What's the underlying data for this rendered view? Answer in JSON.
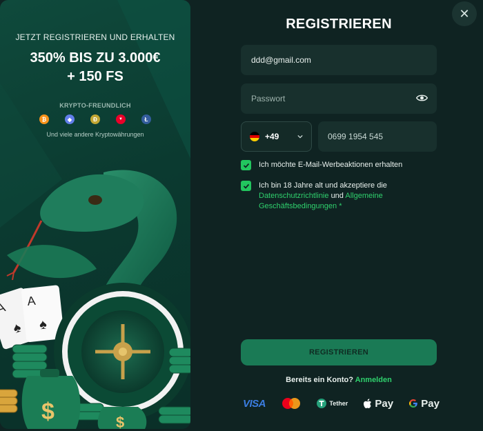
{
  "promo": {
    "subtitle": "JETZT REGISTRIEREN UND ERHALTEN",
    "headline_1": "350% BIS ZU 3.000€",
    "headline_2": "+ 150 FS",
    "crypto_label": "KRYPTO-FREUNDLICH",
    "crypto_note": "Und viele andere Kryptowährungen",
    "coins": [
      {
        "name": "bitcoin-icon",
        "glyph": "₿",
        "color": "#f7931a"
      },
      {
        "name": "ethereum-icon",
        "glyph": "◆",
        "color": "#627eea"
      },
      {
        "name": "dogecoin-icon",
        "glyph": "Ð",
        "color": "#c2a633"
      },
      {
        "name": "tron-icon",
        "glyph": "▼",
        "color": "#eb0029"
      },
      {
        "name": "litecoin-icon",
        "glyph": "Ł",
        "color": "#345d9d"
      }
    ]
  },
  "form": {
    "title": "REGISTRIEREN",
    "email_value": "ddd@gmail.com",
    "password_placeholder": "Passwort",
    "phone_code": "+49",
    "phone_value": "0699 1954 545",
    "checkbox_marketing": "Ich möchte E-Mail-Werbeaktionen erhalten",
    "checkbox_terms_prefix": "Ich bin 18 Jahre alt und akzeptiere die",
    "privacy_link": "Datenschutzrichtlinie",
    "terms_and": "und",
    "terms_link_1": "Allgemeine",
    "terms_link_2": "Geschäftsbedingungen",
    "required_mark": "*",
    "submit_label": "REGISTRIEREN",
    "login_prompt": "Bereits ein Konto?",
    "login_link": "Anmelden"
  },
  "payments": {
    "visa": "VISA",
    "tether": "Tether",
    "applepay": "Pay",
    "googlepay": "Pay"
  },
  "colors": {
    "accent_green": "#22c55e",
    "link_green": "#2fd06d",
    "background": "#0f2322"
  }
}
